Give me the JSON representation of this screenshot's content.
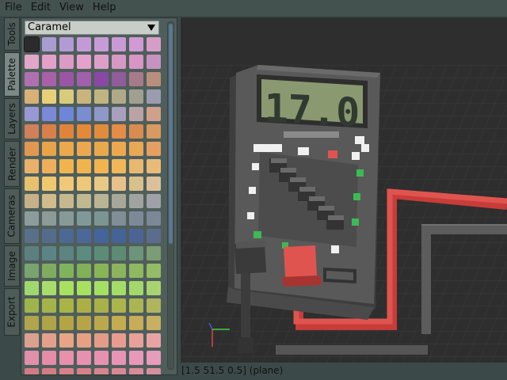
{
  "menu": [
    "File",
    "Edit",
    "View",
    "Help"
  ],
  "side_tabs": [
    {
      "label": "Tools",
      "active": false
    },
    {
      "label": "Palette",
      "active": true
    },
    {
      "label": "Layers",
      "active": false
    },
    {
      "label": "Render",
      "active": false
    },
    {
      "label": "Cameras",
      "active": false
    },
    {
      "label": "Image",
      "active": false
    },
    {
      "label": "Export",
      "active": false
    }
  ],
  "palette": {
    "name": "Caramel",
    "swatches": [
      "#2b2b2b",
      "#a89cd0",
      "#b29ad4",
      "#c49ad6",
      "#c79ad8",
      "#c99ad6",
      "#d19ad4",
      "#d69ec6",
      "#e2a6c8",
      "#e4a0c8",
      "#dc9ac6",
      "#e6a0cc",
      "#dca0c8",
      "#d898c4",
      "#d896c4",
      "#c892c0",
      "#b070b0",
      "#a860a8",
      "#9c54a4",
      "#a060ac",
      "#8848a4",
      "#905c9c",
      "#a67a8a",
      "#b88f7a",
      "#d8b078",
      "#e8d078",
      "#d8cc7c",
      "#c8b47c",
      "#c0b480",
      "#b0aa88",
      "#a0a090",
      "#9c9cb0",
      "#9a98d4",
      "#7c88d8",
      "#6e86d8",
      "#7c8cd0",
      "#9098c8",
      "#a8a0bc",
      "#b8a4a4",
      "#d0a08a",
      "#d0805a",
      "#d8804a",
      "#e0843c",
      "#e4883a",
      "#e08c3c",
      "#e48c48",
      "#d88c50",
      "#d89a60",
      "#e09850",
      "#e8a448",
      "#eca84c",
      "#eca850",
      "#e8a84c",
      "#eca850",
      "#e8a854",
      "#e4a060",
      "#e8b06a",
      "#ecb05c",
      "#f0b44c",
      "#f0b44c",
      "#f0b450",
      "#f0b858",
      "#e8b870",
      "#e8bc78",
      "#e8c070",
      "#f0c870",
      "#f0c878",
      "#ecc878",
      "#e8c884",
      "#e8c08c",
      "#d8c08c",
      "#dcc09c",
      "#c8b088",
      "#d0bc8c",
      "#c8b890",
      "#c0b890",
      "#b8b494",
      "#a8a898",
      "#a0a4a0",
      "#a0a0a8",
      "#8c9c9c",
      "#8c9a98",
      "#889a98",
      "#809898",
      "#7c9494",
      "#808e98",
      "#7c8a98",
      "#7c8898",
      "#587088",
      "#546c8c",
      "#4c6894",
      "#4c6898",
      "#44649c",
      "#446498",
      "#4c6494",
      "#5c6c8c",
      "#5c8080",
      "#5c8486",
      "#5c8480",
      "#5c8c80",
      "#5c8c78",
      "#5c8c74",
      "#6c9478",
      "#7c9c74",
      "#78a470",
      "#80ac60",
      "#80b45c",
      "#80b058",
      "#88b458",
      "#8cb45c",
      "#90b860",
      "#94bc64",
      "#a0d870",
      "#a8dc6c",
      "#a8e060",
      "#a8e060",
      "#a4e064",
      "#a4dc68",
      "#a4d86c",
      "#a8d470",
      "#a0b44c",
      "#a4b448",
      "#a8b444",
      "#acb044",
      "#a8b048",
      "#acb44c",
      "#acb454",
      "#b0b45c",
      "#b0a44c",
      "#b0a448",
      "#b4a444",
      "#b8a448",
      "#bca84c",
      "#c4ac50",
      "#c8ac58",
      "#c8b060",
      "#dca090",
      "#e4a08c",
      "#e8a484",
      "#e8a084",
      "#e49c88",
      "#e89c90",
      "#e8a098",
      "#e8a4a4",
      "#e090a8",
      "#e48ca8",
      "#e890ac",
      "#e890b0",
      "#e890b0",
      "#e894b4",
      "#e898b8",
      "#e89cbc",
      "#d07c84",
      "#d47c84",
      "#d88088",
      "#d8808c",
      "#d88490",
      "#d88894",
      "#d88c98",
      "#d8909c"
    ]
  },
  "viewport": {
    "display_reading": "17.0",
    "colors": {
      "lcd_bg": "#8a9970",
      "lcd_digit": "#303a30",
      "body": "#5a5a5a",
      "accent_red": "#e0504c",
      "wire_gray": "#5c5c5c",
      "grid_bg": "#2e2e2e"
    }
  },
  "status": "[1.5 51.5 0.5] (plane)"
}
